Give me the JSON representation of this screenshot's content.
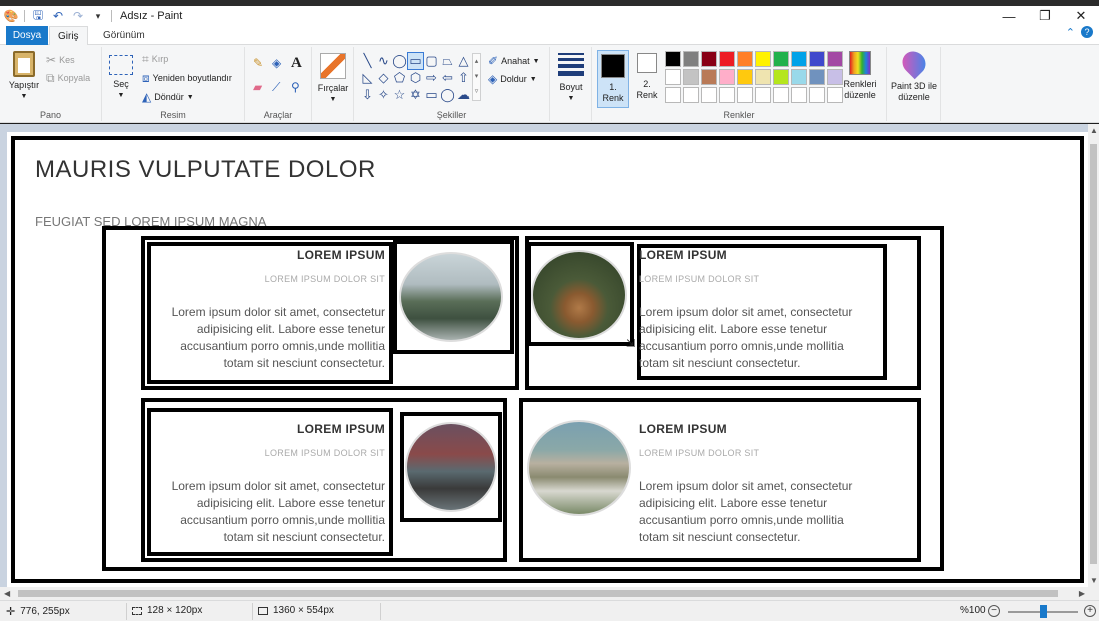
{
  "window": {
    "title": "Adsız - Paint",
    "controls": {
      "minimize": "—",
      "restore": "❐",
      "close": "✕"
    }
  },
  "tabs": {
    "file": "Dosya",
    "home": "Giriş",
    "view": "Görünüm"
  },
  "ribbon": {
    "clipboard": {
      "label": "Pano",
      "paste": "Yapıştır",
      "cut": "Kes",
      "copy": "Kopyala"
    },
    "image": {
      "label": "Resim",
      "select": "Seç",
      "crop": "Kırp",
      "resize": "Yeniden boyutlandır",
      "rotate": "Döndür"
    },
    "tools": {
      "label": "Araçlar"
    },
    "brushes": {
      "label": "Fırçalar"
    },
    "shapes": {
      "label": "Şekiller",
      "outline": "Anahat",
      "fill": "Doldur"
    },
    "size": {
      "label": "Boyut"
    },
    "colors": {
      "label": "Renkler",
      "color1_line1": "1.",
      "color1_line2": "Renk",
      "color2_line1": "2.",
      "color2_line2": "Renk",
      "edit_line1": "Renkleri",
      "edit_line2": "düzenle",
      "paint3d_line1": "Paint 3D ile",
      "paint3d_line2": "düzenle",
      "palette_row1": [
        "#000000",
        "#7f7f7f",
        "#880015",
        "#ed1c24",
        "#ff7f27",
        "#fff200",
        "#22b14c",
        "#00a2e8",
        "#3f48cc",
        "#a349a4"
      ],
      "palette_row2": [
        "#ffffff",
        "#c3c3c3",
        "#b97a57",
        "#ffaec9",
        "#ffc90e",
        "#efe4b0",
        "#b5e61d",
        "#99d9ea",
        "#7092be",
        "#c8bfe7"
      ]
    }
  },
  "canvas": {
    "heading": "MAURIS VULPUTATE DOLOR",
    "subheading": "FEUGIAT SED LOREM IPSUM MAGNA",
    "cards": [
      {
        "title": "LOREM IPSUM",
        "sub": "LOREM IPSUM DOLOR SIT",
        "line1": "Lorem ipsum dolor sit amet, consectetur",
        "line2": "adipisicing elit. Labore esse tenetur",
        "line3": "accusantium porro omnis,unde mollitia",
        "line4": "totam sit nesciunt consectetur."
      },
      {
        "title": "LOREM IPSUM",
        "sub": "LOREM IPSUM DOLOR SIT",
        "line1": "Lorem ipsum dolor sit amet, consectetur",
        "line2": "adipisicing elit. Labore esse tenetur",
        "line3": "accusantium porro omnis,unde mollitia",
        "line4": "totam sit nesciunt consectetur."
      },
      {
        "title": "LOREM IPSUM",
        "sub": "LOREM IPSUM DOLOR SIT",
        "line1": "Lorem ipsum dolor sit amet, consectetur",
        "line2": "adipisicing elit. Labore esse tenetur",
        "line3": "accusantium porro omnis,unde mollitia",
        "line4": "totam sit nesciunt consectetur."
      },
      {
        "title": "LOREM IPSUM",
        "sub": "LOREM IPSUM DOLOR SIT",
        "line1": "Lorem ipsum dolor sit amet, consectetur",
        "line2": "adipisicing elit. Labore esse tenetur",
        "line3": "accusantium porro omnis,unde mollitia",
        "line4": "totam sit nesciunt consectetur."
      }
    ]
  },
  "status": {
    "cursor_pos": "776, 255px",
    "selection_size": "128 × 120px",
    "image_size": "1360 × 554px",
    "zoom": "%100"
  },
  "colors": {
    "accent": "#1979ca",
    "ribbon_bg": "#f5f6f7",
    "canvas_bg": "#c9d3e0"
  }
}
